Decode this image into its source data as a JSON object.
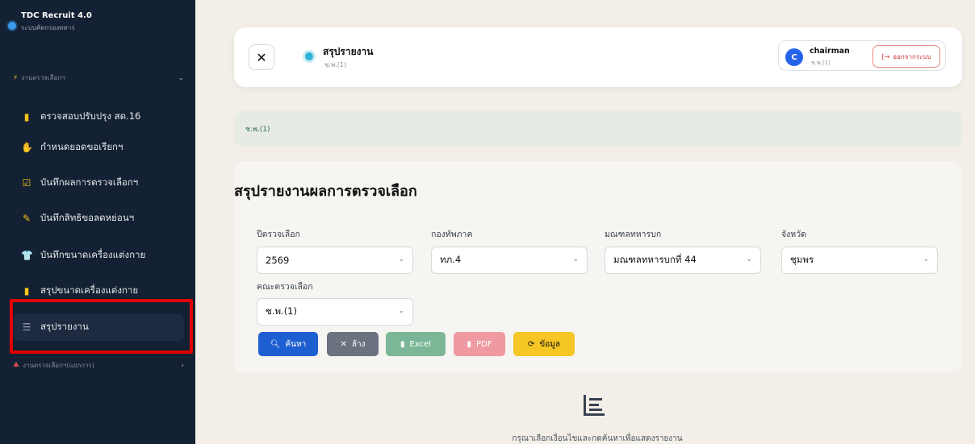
{
  "app": {
    "title": "TDC Recruit 4.0",
    "subtitle": "ระบบคัดกรองทหาร"
  },
  "sidebar": {
    "group_top": {
      "label": "งานตรวจเลือกฯ",
      "icon": "bolt-icon"
    },
    "items": [
      {
        "label": "ตรวจสอบปรับปรุง สด.16",
        "icon": "clipboard-icon",
        "color": "#f5c518"
      },
      {
        "label": "กำหนดยอดขอเรียกฯ",
        "icon": "hand-icon",
        "color": "#f5c518"
      },
      {
        "label": "บันทึกผลการตรวจเลือกฯ",
        "icon": "checkbox-icon",
        "color": "#f5c518"
      },
      {
        "label": "บันทึกสิทธิขอลดหย่อนฯ",
        "icon": "edit-doc-icon",
        "color": "#f5c518"
      },
      {
        "label": "บันทึกขนาดเครื่องแต่งกาย",
        "icon": "shirt-icon",
        "color": "#f5c518"
      },
      {
        "label": "สรุปขนาดเครื่องแต่งกาย",
        "icon": "file-icon",
        "color": "#f5c518"
      },
      {
        "label": "สรุปรายงาน",
        "icon": "list-icon",
        "color": "#9aa4b3",
        "active": true
      }
    ],
    "group_bottom": {
      "label": "งานตรวจเลือกฯ(แยกการ)",
      "icon": "sitemap-icon"
    }
  },
  "header": {
    "title": "สรุปรายงาน",
    "subtitle": "ช.พ.(1)",
    "user": {
      "initial": "C",
      "name": "chairman",
      "role": "ช.พ.(1)"
    },
    "logout_label": "ออกจากระบบ"
  },
  "breadcrumb": "ช.พ.(1)",
  "section_title": "สรุปรายงานผลการตรวจเลือก",
  "filters": {
    "year": {
      "label": "ปีตรวจเลือก",
      "value": "2569"
    },
    "army": {
      "label": "กองทัพภาค",
      "value": "ทภ.4"
    },
    "district": {
      "label": "มณฑลทหารบก",
      "value": "มณฑลทหารบกที่ 44"
    },
    "province": {
      "label": "จังหวัด",
      "value": "ชุมพร"
    },
    "committee": {
      "label": "คณะตรวจเลือก",
      "value": "ช.พ.(1)"
    }
  },
  "buttons": {
    "search": "ค้นหา",
    "clear": "ล้าง",
    "excel": "Excel",
    "pdf": "PDF",
    "data": "ข้อมูล"
  },
  "empty_state": "กรุณาเลือกเงื่อนไขและกดค้นหาเพื่อแสดงรายงาน",
  "colors": {
    "sidebar": "#142033",
    "primary": "#1d5fd0",
    "highlight": "#e00000"
  }
}
